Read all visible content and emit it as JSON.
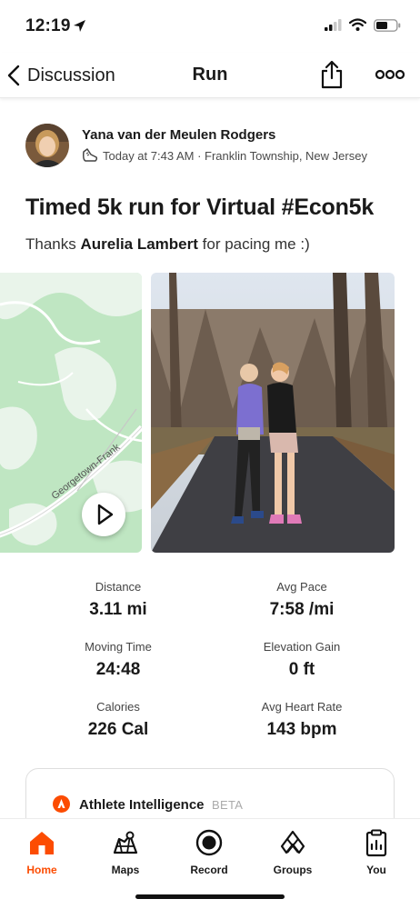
{
  "status_bar": {
    "time": "12:19"
  },
  "nav": {
    "back_label": "Discussion",
    "title": "Run"
  },
  "activity": {
    "athlete_name": "Yana van der Meulen Rodgers",
    "meta": "Today at 7:43 AM · Franklin Township, New Jersey",
    "title": "Timed 5k run for Virtual #Econ5k",
    "description_prefix": "Thanks ",
    "description_mention": "Aurelia Lambert",
    "description_suffix": " for pacing me :)",
    "map_road_label": "Georgetown-Frank"
  },
  "stats": [
    {
      "label": "Distance",
      "value": "3.11 mi"
    },
    {
      "label": "Avg Pace",
      "value": "7:58 /mi"
    },
    {
      "label": "Moving Time",
      "value": "24:48"
    },
    {
      "label": "Elevation Gain",
      "value": "0 ft"
    },
    {
      "label": "Calories",
      "value": "226 Cal"
    },
    {
      "label": "Avg Heart Rate",
      "value": "143 bpm"
    }
  ],
  "athlete_intelligence": {
    "title": "Athlete Intelligence",
    "badge": "BETA"
  },
  "tabbar": {
    "items": [
      {
        "label": "Home",
        "icon": "home-icon"
      },
      {
        "label": "Maps",
        "icon": "maps-icon"
      },
      {
        "label": "Record",
        "icon": "record-icon"
      },
      {
        "label": "Groups",
        "icon": "groups-icon"
      },
      {
        "label": "You",
        "icon": "clipboard-icon"
      }
    ],
    "active": "Home"
  },
  "colors": {
    "brand": "#fc4c02",
    "map_green": "#b9e4bd",
    "map_light": "#e9f4ea"
  }
}
